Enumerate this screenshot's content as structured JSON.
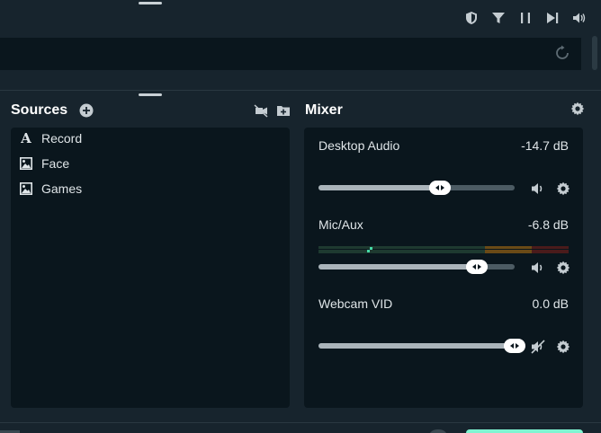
{
  "toolbar": {
    "icons": [
      "shield-icon",
      "filter-icon",
      "pause-icon",
      "skip-next-icon",
      "volume-icon"
    ]
  },
  "sources": {
    "title": "Sources",
    "items": [
      {
        "label": "Record",
        "icon": "text-icon"
      },
      {
        "label": "Face",
        "icon": "image-icon"
      },
      {
        "label": "Games",
        "icon": "image-icon"
      }
    ]
  },
  "mixer": {
    "title": "Mixer",
    "channels": [
      {
        "name": "Desktop Audio",
        "db": "-14.7 dB",
        "level": 0.62,
        "muted": false
      },
      {
        "name": "Mic/Aux",
        "db": "-6.8 dB",
        "level": 0.81,
        "muted": false
      },
      {
        "name": "Webcam VID",
        "db": "0.0 dB",
        "level": 1.0,
        "muted": true
      }
    ]
  },
  "colors": {
    "background": "#17242d",
    "panel": "#0a161d",
    "accent": "#80f5d2",
    "meter_green": "#1e3a30",
    "meter_orange": "#6a4a16",
    "meter_red": "#4a1b1b"
  }
}
